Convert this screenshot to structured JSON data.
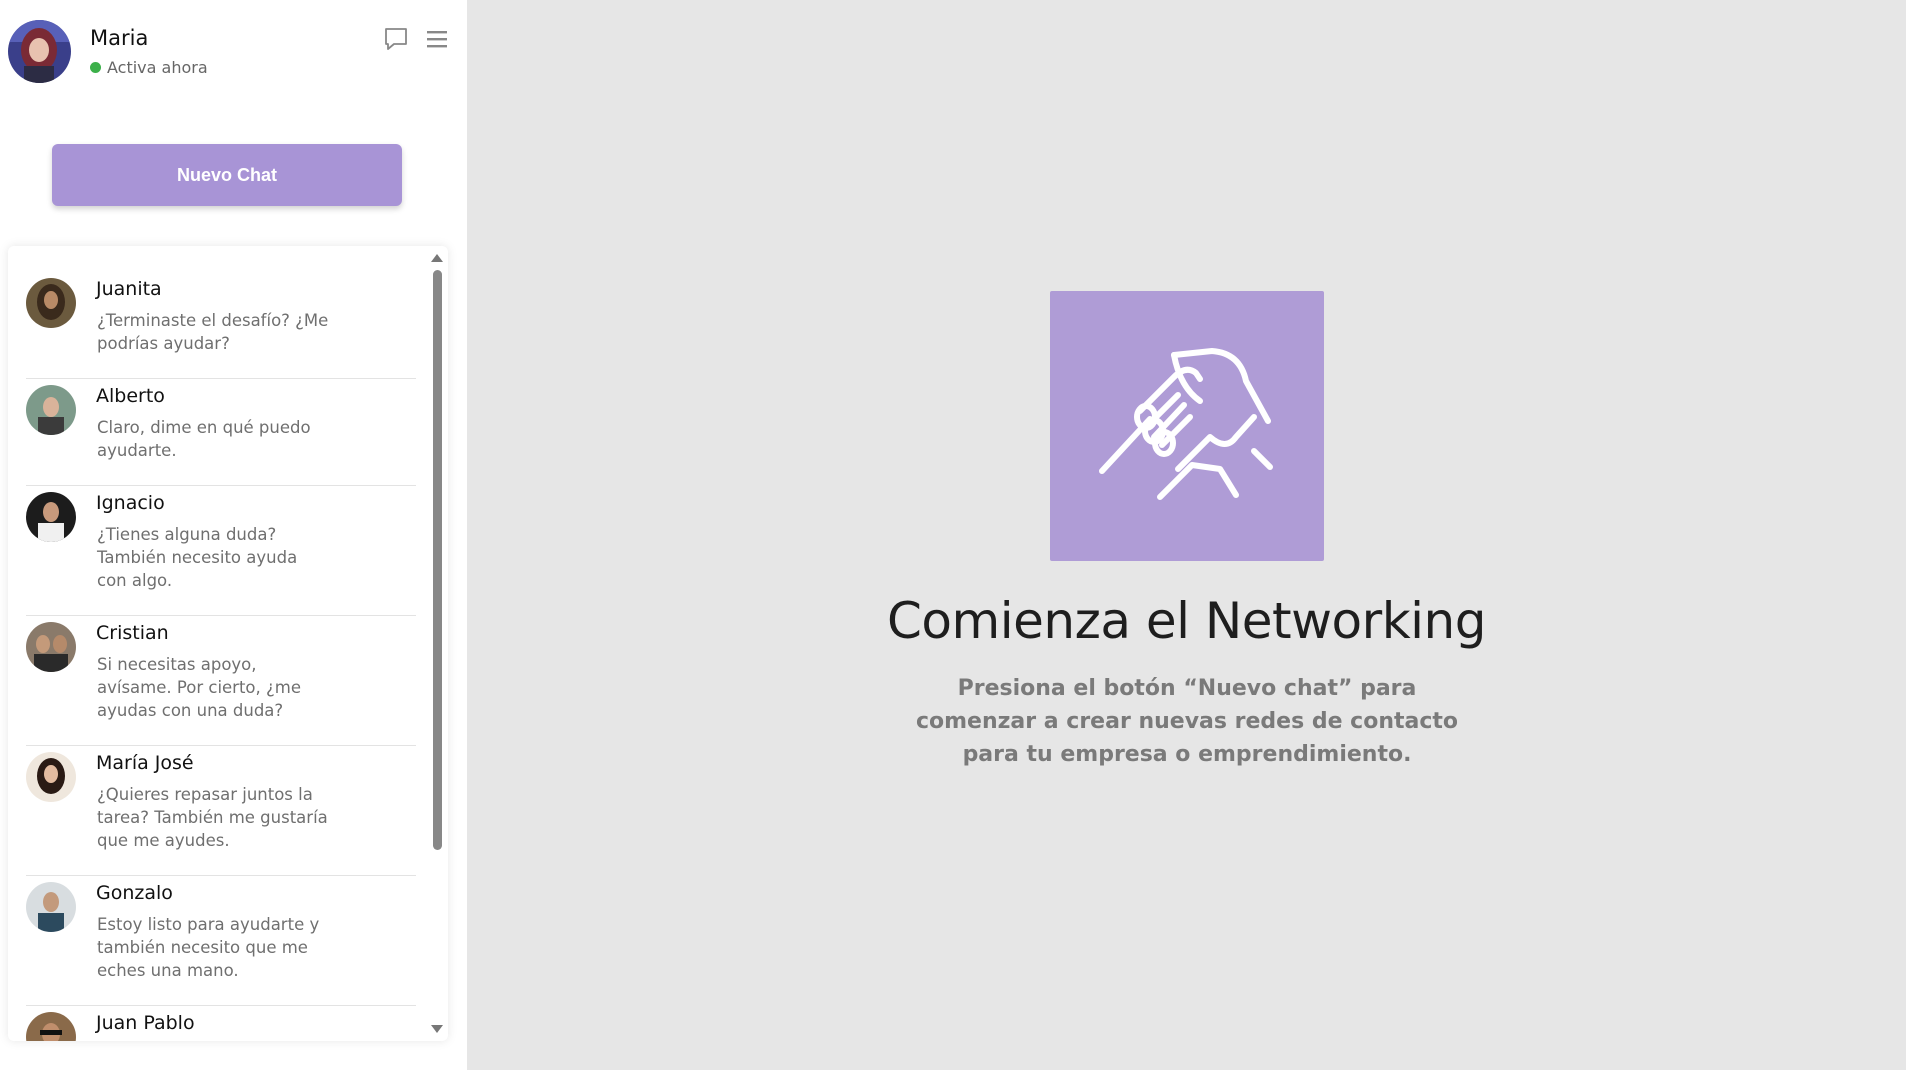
{
  "user": {
    "name": "Maria",
    "status": "Activa ahora"
  },
  "header_icons": [
    "chat-bubble-icon",
    "menu-icon"
  ],
  "new_chat_label": "Nuevo Chat",
  "chats": [
    {
      "name": "Juanita",
      "message": "¿Terminaste el desafío? ¿Me podrías ayudar?"
    },
    {
      "name": "Alberto",
      "message": "Claro, dime en qué puedo ayudarte."
    },
    {
      "name": "Ignacio",
      "message": "¿Tienes alguna duda? También necesito ayuda con algo."
    },
    {
      "name": "Cristian",
      "message": "Si necesitas apoyo, avísame. Por cierto, ¿me ayudas con una duda?"
    },
    {
      "name": "María José",
      "message": "¿Quieres repasar juntos la tarea? También me gustaría que me ayudes."
    },
    {
      "name": "Gonzalo",
      "message": "Estoy listo para ayudarte y también necesito que me eches una mano."
    },
    {
      "name": "Juan Pablo",
      "message": ""
    }
  ],
  "hero": {
    "icon": "handshake-icon",
    "title": "Comienza el Networking",
    "text": "Presiona el botón “Nuevo chat” para comenzar a crear nuevas redes de contacto para tu empresa o emprendimiento."
  },
  "colors": {
    "accent": "#a894d6",
    "hero_box": "#af9cd6",
    "status_online": "#3cb04a",
    "background": "#e6e6e6"
  }
}
